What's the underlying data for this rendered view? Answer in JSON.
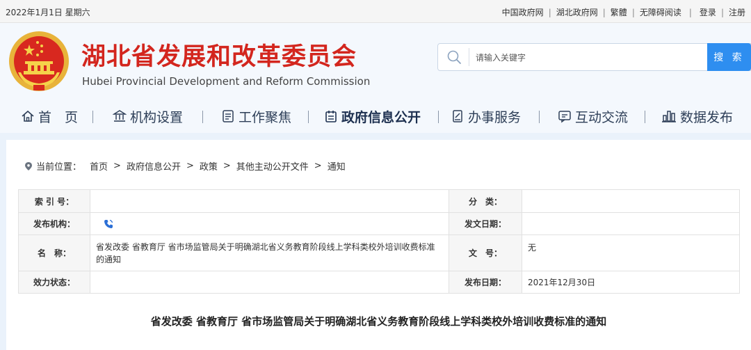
{
  "topbar": {
    "date": "2022年1月1日 星期六",
    "links": [
      "中国政府网",
      "湖北政府网",
      "繁體",
      "无障碍阅读",
      "登录",
      "注册"
    ]
  },
  "header": {
    "title_cn": "湖北省发展和改革委员会",
    "title_en": "Hubei Provincial Development and Reform Commission"
  },
  "search": {
    "placeholder": "请输入关键字",
    "button": "搜 索"
  },
  "nav": {
    "items": [
      {
        "label": "首　页",
        "icon": "home-icon"
      },
      {
        "label": "机构设置",
        "icon": "institution-icon"
      },
      {
        "label": "工作聚焦",
        "icon": "document-icon"
      },
      {
        "label": "政府信息公开",
        "icon": "calendar-icon",
        "active": true
      },
      {
        "label": "办事服务",
        "icon": "service-icon"
      },
      {
        "label": "互动交流",
        "icon": "chat-icon"
      },
      {
        "label": "数据发布",
        "icon": "bar-chart-icon"
      }
    ]
  },
  "breadcrumb": {
    "prefix": "当前位置：",
    "items": [
      "首页",
      "政府信息公开",
      "政策",
      "其他主动公开文件",
      "通知"
    ],
    "separator": ">"
  },
  "info_table": {
    "index_label": "索 引 号：",
    "index_value": "",
    "category_label": "分　类：",
    "category_value": "",
    "publisher_label": "发布机构：",
    "publisher_value": "",
    "issue_date_label": "发文日期：",
    "issue_date_value": "",
    "name_label": "名　称：",
    "name_value": "省发改委 省教育厅 省市场监管局关于明确湖北省义务教育阶段线上学科类校外培训收费标准的通知",
    "doc_no_label": "文　号：",
    "doc_no_value": "无",
    "status_label": "效力状态：",
    "status_value": "",
    "publish_date_label": "发布日期：",
    "publish_date_value": "2021年12月30日"
  },
  "document": {
    "title": "省发改委 省教育厅 省市场监管局关于明确湖北省义务教育阶段线上学科类校外培训收费标准的通知"
  },
  "colors": {
    "title_red": "#d3261e",
    "search_blue": "#2e8ef0",
    "nav_text": "#2e3f58",
    "page_bg": "#eaf2fb"
  }
}
